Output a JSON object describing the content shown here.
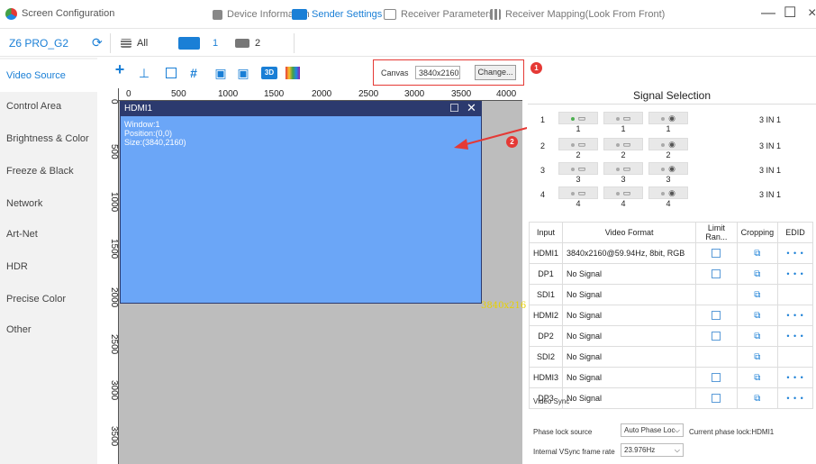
{
  "app": {
    "title": "Screen Configuration"
  },
  "nav_tabs": [
    {
      "label": "Device Information",
      "active": false
    },
    {
      "label": "Sender Settings",
      "active": true
    },
    {
      "label": "Receiver Parameters",
      "active": false
    },
    {
      "label": "Receiver Mapping(Look From Front)",
      "active": false
    }
  ],
  "window_controls": {
    "minimize": "—",
    "maximize": "☐",
    "close": "×"
  },
  "device": {
    "name": "Z6 PRO_G2",
    "tabs": [
      {
        "label": "All"
      },
      {
        "label": "1",
        "active": true
      },
      {
        "label": "2"
      }
    ]
  },
  "sidebar": {
    "items": [
      {
        "label": "Video Source",
        "active": true
      },
      {
        "label": "Control Area"
      },
      {
        "label": "Brightness & Color"
      },
      {
        "label": "Freeze & Black"
      },
      {
        "label": "Network"
      },
      {
        "label": "Art-Net"
      },
      {
        "label": "HDR"
      },
      {
        "label": "Precise Color"
      },
      {
        "label": "Other"
      }
    ]
  },
  "toolbar": {
    "3d_label": "3D"
  },
  "canvas": {
    "label": "Canvas",
    "value": "3840x2160",
    "change_label": "Change..."
  },
  "annotations": {
    "badge1": "1",
    "badge2": "2",
    "color": "#e53935"
  },
  "ruler": {
    "h_ticks": [
      "0",
      "500",
      "1000",
      "1500",
      "2000",
      "2500",
      "3000",
      "3500",
      "4000"
    ],
    "v_ticks": [
      "0",
      "500",
      "1000",
      "1500",
      "2000",
      "2500",
      "3000",
      "3500"
    ]
  },
  "window": {
    "title": "HDMI1",
    "info": [
      "Window:1",
      "Position:(0,0)",
      "Size:(3840,2160)"
    ],
    "resolution_label": "3840x216"
  },
  "signal_selection": {
    "title": "Signal Selection",
    "rows": [
      {
        "num": "1",
        "ports": [
          "1",
          "1",
          "1"
        ],
        "active_port": 0,
        "mode": "3 IN 1"
      },
      {
        "num": "2",
        "ports": [
          "2",
          "2",
          "2"
        ],
        "active_port": -1,
        "mode": "3 IN 1"
      },
      {
        "num": "3",
        "ports": [
          "3",
          "3",
          "3"
        ],
        "active_port": -1,
        "mode": "3 IN 1"
      },
      {
        "num": "4",
        "ports": [
          "4",
          "4",
          "4"
        ],
        "active_port": -1,
        "mode": "3 IN 1"
      }
    ]
  },
  "video_table": {
    "headers": [
      "Input",
      "Video Format",
      "Limit Ran...",
      "Cropping",
      "EDID"
    ],
    "rows": [
      {
        "input": "HDMI1",
        "format": "3840x2160@59.94Hz, 8bit, RGB",
        "limit": true,
        "edid": true
      },
      {
        "input": "DP1",
        "format": "No Signal",
        "limit": true,
        "edid": true
      },
      {
        "input": "SDI1",
        "format": "No Signal",
        "limit": false,
        "edid": false
      },
      {
        "input": "HDMI2",
        "format": "No Signal",
        "limit": true,
        "edid": true
      },
      {
        "input": "DP2",
        "format": "No Signal",
        "limit": true,
        "edid": true
      },
      {
        "input": "SDI2",
        "format": "No Signal",
        "limit": false,
        "edid": false
      },
      {
        "input": "HDMI3",
        "format": "No Signal",
        "limit": true,
        "edid": true
      },
      {
        "input": "DP3",
        "format": "No Signal",
        "limit": true,
        "edid": true
      }
    ],
    "edid_dots": "• • •"
  },
  "video_sync": {
    "title": "Video Sync",
    "phase_lock_label": "Phase lock source",
    "phase_lock_value": "Auto Phase Loc",
    "current_phase": "Current phase lock:HDMI1",
    "vsync_label": "Internal VSync frame rate",
    "vsync_value": "23.976Hz"
  }
}
